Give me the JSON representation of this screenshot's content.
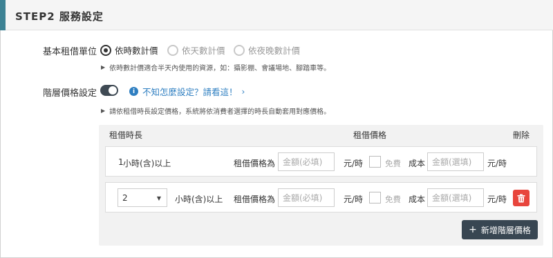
{
  "header": {
    "title": "STEP2 服務設定"
  },
  "rental_unit": {
    "label": "基本租借單位",
    "options": [
      {
        "label": "依時數計價",
        "checked": true
      },
      {
        "label": "依天數計價",
        "checked": false
      },
      {
        "label": "依夜晚數計價",
        "checked": false
      }
    ],
    "hint": "依時數計價適合半天內使用的資源，如：攝影棚、會議場地、腳踏車等。"
  },
  "tiered_pricing": {
    "label": "階層價格設定",
    "enabled": true,
    "help_link": "不知怎麼設定？請看這！",
    "hint": "請依租借時長設定價格，系統將依消費者選擇的時長自動套用對應價格。"
  },
  "table": {
    "col_duration": "租借時長",
    "col_price": "租借價格",
    "col_delete": "刪除",
    "rows": [
      {
        "duration_value": "1",
        "duration_suffix": "小時(含)以上",
        "price_label": "租借價格為",
        "price_placeholder": "金額(必填)",
        "price_unit": "元/時",
        "free_label": "免費",
        "cost_label": "成本",
        "cost_placeholder": "金額(選填)",
        "cost_unit": "元/時"
      },
      {
        "duration_value": "2",
        "duration_suffix": "小時(含)以上",
        "price_label": "租借價格為",
        "price_placeholder": "金額(必填)",
        "price_unit": "元/時",
        "free_label": "免費",
        "cost_label": "成本",
        "cost_placeholder": "金額(選填)",
        "cost_unit": "元/時"
      }
    ]
  },
  "add_button": {
    "label": "新增階層價格"
  },
  "colors": {
    "accent": "#3d8294",
    "link": "#2f7fc1",
    "danger": "#e8453c",
    "dark_button": "#384652"
  }
}
